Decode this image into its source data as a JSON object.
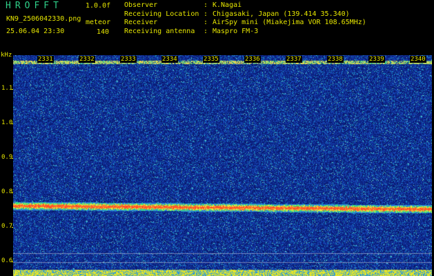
{
  "header": {
    "app_title": "HROFFT",
    "version": "1.0.0f",
    "filename": "KN9_2506042330.png",
    "datetime": "25.06.04 23:30",
    "meteor_label": "meteor",
    "meteor_count": "140"
  },
  "info": [
    {
      "label": "Observer",
      "sep": ":",
      "value": "K.Nagai"
    },
    {
      "label": "Receiving Location",
      "sep": ":",
      "value": "Chigasaki, Japan (139.414 35.340)"
    },
    {
      "label": "Receiver",
      "sep": ":",
      "value": "AirSpy mini (Miakejima VOR 108.65MHz)"
    },
    {
      "label": "Receiving antenna",
      "sep": ":",
      "value": "Maspro FM-3"
    }
  ],
  "plot": {
    "y_unit": "kHz",
    "y_ticks": [
      "1.1",
      "1.0",
      "0.9",
      "0.8",
      "0.7",
      "0.6"
    ],
    "x_ticks": [
      "2331",
      "2332",
      "2333",
      "2334",
      "2335",
      "2336",
      "2337",
      "2338",
      "2339",
      "2340"
    ]
  },
  "colors": {
    "background": "#000000",
    "label": "#e6e600",
    "title": "#2fd08a",
    "noise_low": "#0a1a6e",
    "noise_mid": "#1e4fb0",
    "signal": "#ff3030"
  }
}
